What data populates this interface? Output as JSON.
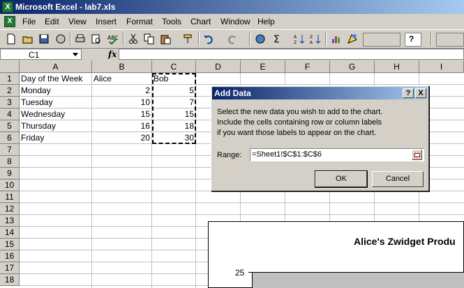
{
  "window": {
    "title": "Microsoft Excel - lab7.xls"
  },
  "menu": [
    "File",
    "Edit",
    "View",
    "Insert",
    "Format",
    "Tools",
    "Chart",
    "Window",
    "Help"
  ],
  "formula_bar": {
    "name_box": "C1",
    "fx": "fx",
    "formula": ""
  },
  "columns": [
    "A",
    "B",
    "C",
    "D",
    "E",
    "F",
    "G",
    "H",
    "I"
  ],
  "rows": [
    "1",
    "2",
    "3",
    "4",
    "5",
    "6",
    "7",
    "8",
    "9",
    "10",
    "11",
    "12",
    "13",
    "14",
    "15",
    "16",
    "17",
    "18"
  ],
  "cells": {
    "r1": [
      "Day of the Week",
      "Alice",
      "Bob"
    ],
    "r2": [
      "Monday",
      "2",
      "5"
    ],
    "r3": [
      "Tuesday",
      "10",
      "7"
    ],
    "r4": [
      "Wednesday",
      "15",
      "15"
    ],
    "r5": [
      "Thursday",
      "16",
      "18"
    ],
    "r6": [
      "Friday",
      "20",
      "30"
    ]
  },
  "chart": {
    "title": "Alice's Zwidget Produ",
    "y_tick": "25"
  },
  "dialog": {
    "title": "Add Data",
    "help": "?",
    "close": "X",
    "line1": "Select the new data you wish to add to the chart.",
    "line2": "Include the cells containing row or column labels",
    "line3": "if you want those labels to appear on the chart.",
    "range_label": "Range:",
    "range_value": "=Sheet1!$C$1:$C$6",
    "ok": "OK",
    "cancel": "Cancel"
  }
}
